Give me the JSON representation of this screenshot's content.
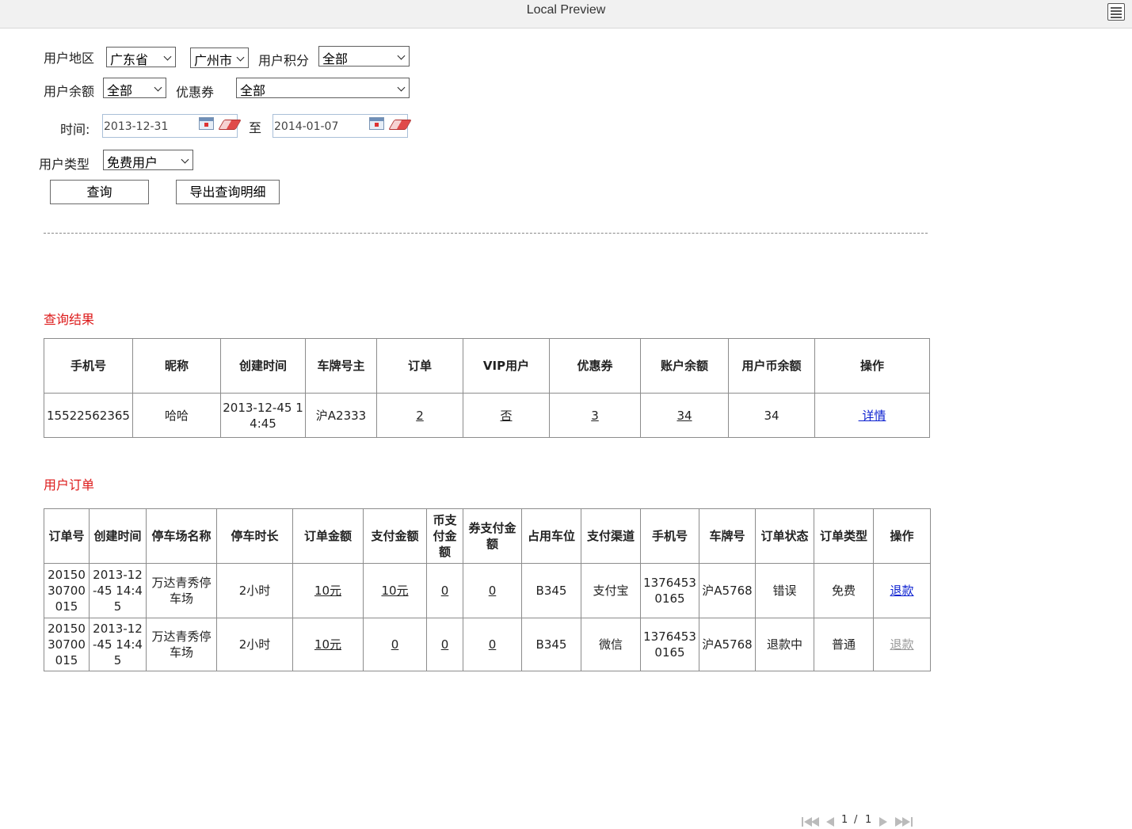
{
  "window": {
    "title": "Local Preview",
    "menu_icon": "menu-icon"
  },
  "filters": {
    "region_label": "用户地区",
    "province": "广东省",
    "city": "广州市",
    "points_label": "用户积分",
    "points": "全部",
    "balance_label": "用户余额",
    "balance": "全部",
    "coupon_label": "优惠券",
    "coupon": "全部",
    "time_label": "时间:",
    "date_from": "2013-12-31",
    "date_to_label": "至",
    "date_to": "2014-01-07",
    "user_type_label": "用户类型",
    "user_type": "免费用户"
  },
  "actions": {
    "query": "查询",
    "export": "导出查询明细"
  },
  "results": {
    "title": "查询结果",
    "headers": [
      "手机号",
      "昵称",
      "创建时间",
      "车牌号主",
      "订单",
      "VIP用户",
      "优惠券",
      "账户余额",
      "用户币余额",
      "操作"
    ],
    "row": {
      "phone": "15522562365",
      "nickname": "哈哈",
      "created": "2013-12-45 14:45",
      "plate": "沪A2333",
      "orders": "2",
      "vip": "否",
      "coupons": "3",
      "balance": "34",
      "coin_balance": "34",
      "action": " 详情"
    }
  },
  "orders": {
    "title": "用户订单",
    "headers": [
      "订单号",
      "创建时间",
      "停车场名称",
      "停车时长",
      "订单金额",
      "支付金额",
      "币支付金额",
      "券支付金额",
      "占用车位",
      "支付渠道",
      "手机号",
      "车牌号",
      "订单状态",
      "订单类型",
      "操作"
    ],
    "rows": [
      {
        "order_no": "2015030700015",
        "created": "2013-12-45 14:45",
        "lot": "万达青秀停车场",
        "duration": "2小时",
        "amount": "10元",
        "paid": "10元",
        "coin_paid": "0",
        "coupon_paid": "0",
        "space": "B345",
        "channel": "支付宝",
        "phone": "13764530165",
        "plate": "沪A5768",
        "status": "错误",
        "type": "免费",
        "action": "退款"
      },
      {
        "order_no": "2015030700015",
        "created": "2013-12-45 14:45",
        "lot": "万达青秀停车场",
        "duration": "2小时",
        "amount": "10元",
        "paid": "0",
        "coin_paid": "0",
        "coupon_paid": "0",
        "space": "B345",
        "channel": "微信",
        "phone": "13764530165",
        "plate": "沪A5768",
        "status": "退款中",
        "type": "普通",
        "action": "退款"
      }
    ]
  },
  "pager": {
    "current": "1",
    "separator": "/",
    "total": "1"
  }
}
